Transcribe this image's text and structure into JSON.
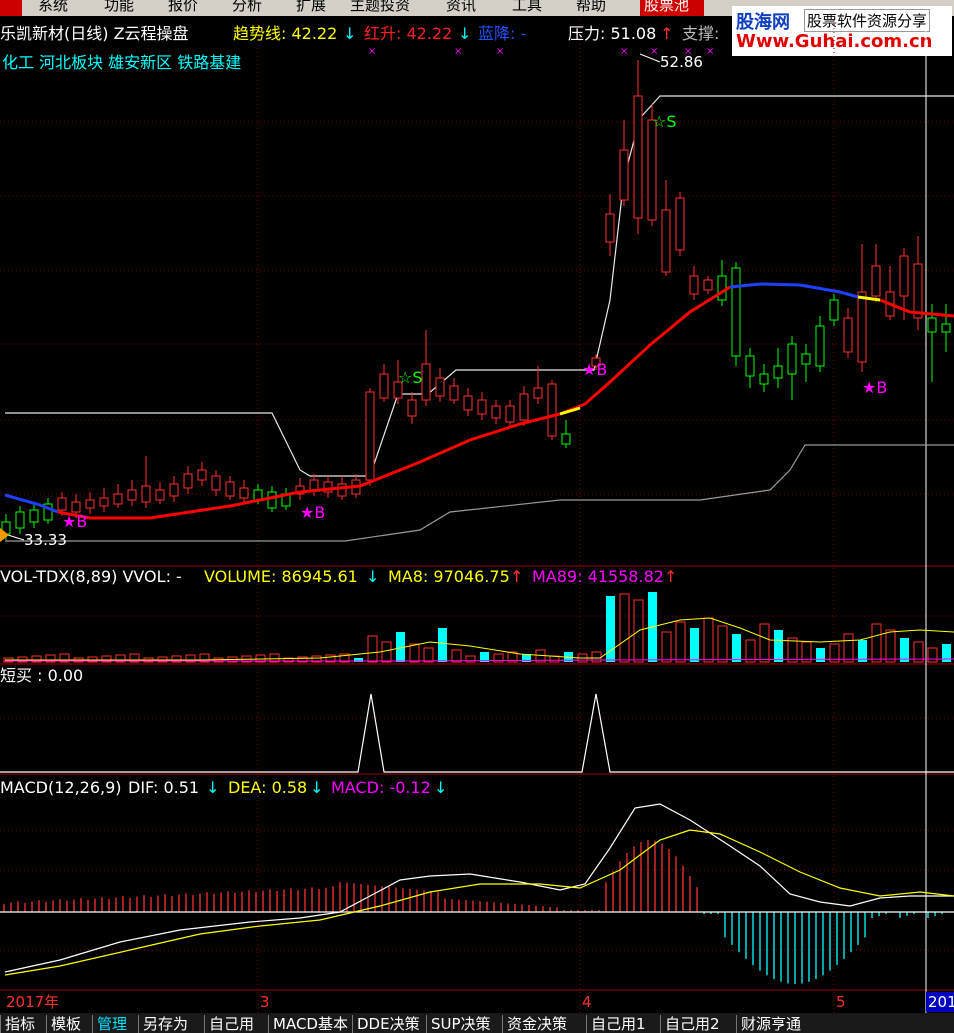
{
  "menu": {
    "items": [
      "系统",
      "功能",
      "报价",
      "分析",
      "扩展",
      "主题投资",
      "资讯",
      "工具",
      "帮助"
    ],
    "pool_tab": "股票池"
  },
  "watermark": {
    "brand": "股海网",
    "slogan": "股票软件资源分享",
    "url": "Www.Guhai.com.cn"
  },
  "header": {
    "title": "乐凯新材(日线) Z云程操盘",
    "trend_label": "趋势线: 42.22",
    "trend_arrow": "↓",
    "red_label": "红升: 42.22",
    "red_arrow": "↓",
    "blue_label": "蓝降: -",
    "pressure_label": "压力: 51.08",
    "pressure_arrow": "↑",
    "support_label": "支撑:"
  },
  "sectors": "化工 河北板块 雄安新区 铁路基建",
  "price_labels": {
    "high": "52.86",
    "low": "33.33"
  },
  "signals": {
    "buy": "★B",
    "sell": "☆S"
  },
  "volume_panel": {
    "name": "VOL-TDX(8,89) VVOL: -",
    "volume": "VOLUME: 86945.61",
    "volume_arrow": "↓",
    "ma8": "MA8: 97046.75",
    "ma8_arrow": "↑",
    "ma89": "MA89: 41558.82",
    "ma89_arrow": "↑"
  },
  "short_buy_panel": {
    "name": "短买 : 0.00"
  },
  "macd_panel": {
    "name": "MACD(12,26,9)",
    "dif": "DIF: 0.51",
    "dif_arrow": "↓",
    "dea": "DEA: 0.58",
    "dea_arrow": "↓",
    "macd": "MACD: -0.12",
    "macd_arrow": "↓"
  },
  "time_axis": {
    "labels": [
      "2017年",
      "3",
      "4",
      "5",
      "201"
    ]
  },
  "bottom_tabs": [
    "指标",
    "模板",
    "管理",
    "另存为",
    "自己用",
    "MACD基本",
    "DDE决策",
    "SUP决策",
    "资金决策",
    "自己用1",
    "自己用2",
    "财源亨通"
  ],
  "colors": {
    "up": "#ff3030",
    "down": "#00ff00",
    "trend_red": "#ff0000",
    "trend_blue": "#2040ff",
    "yellow": "#ffff00",
    "magenta": "#ff00ff",
    "cyan": "#00ffff",
    "white": "#ffffff"
  }
}
